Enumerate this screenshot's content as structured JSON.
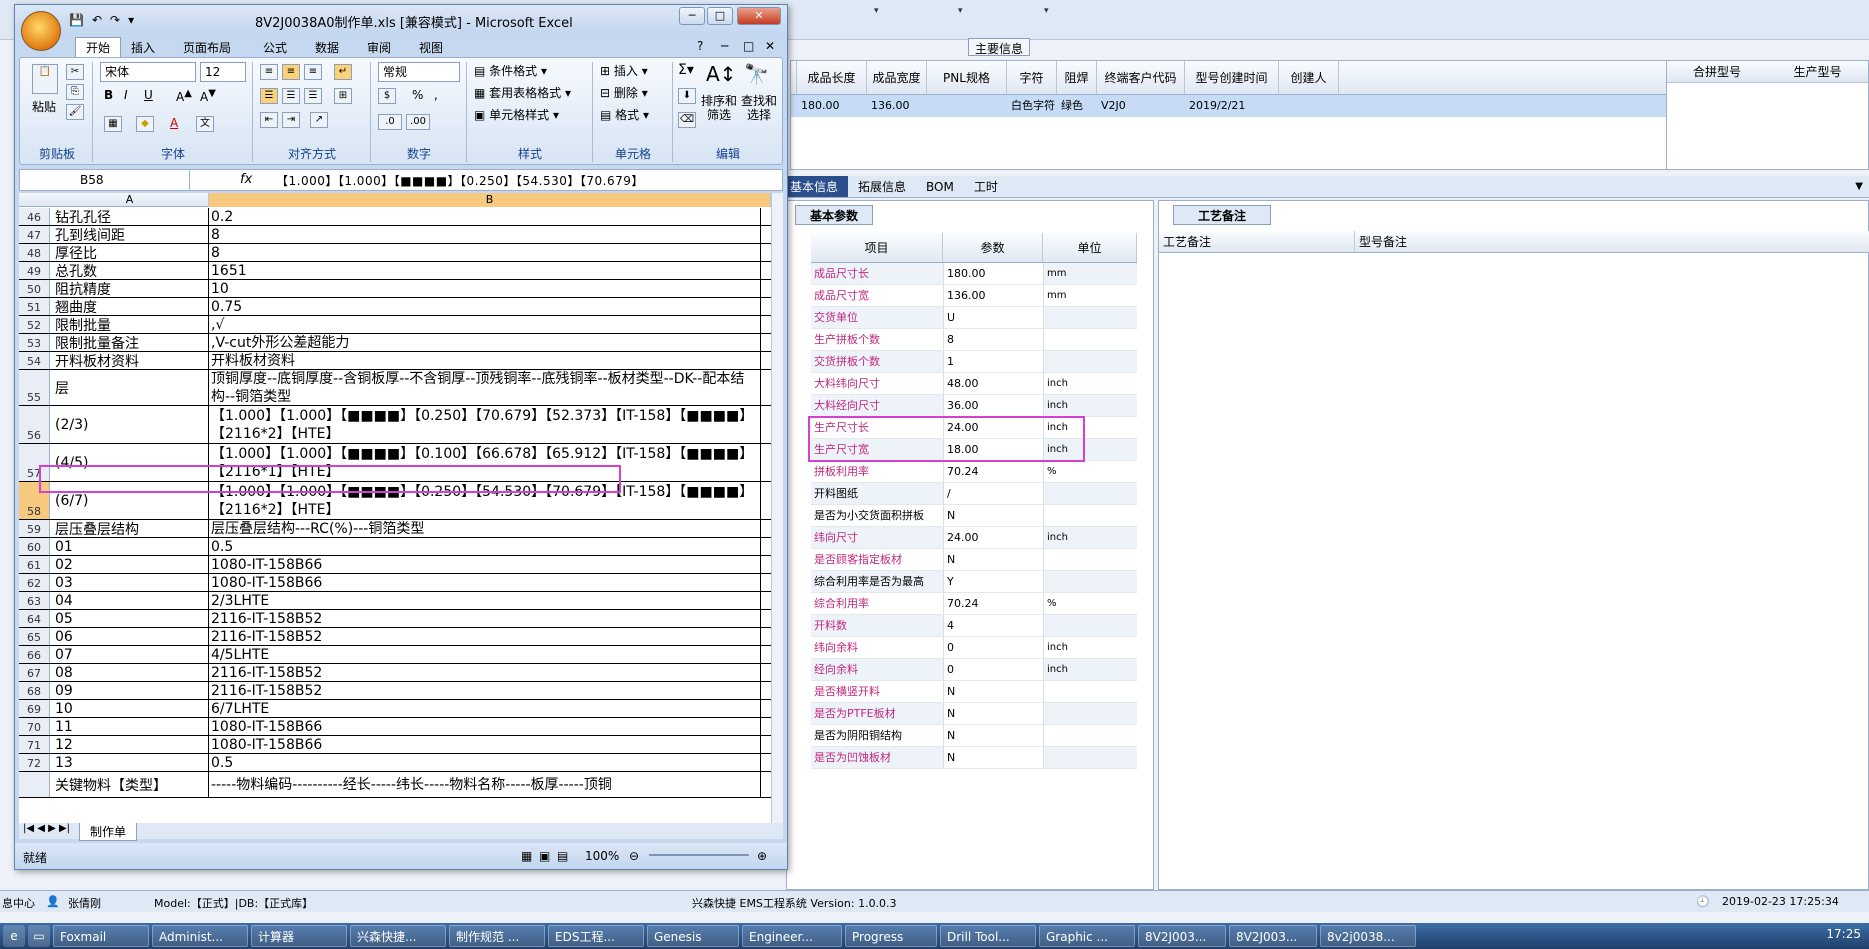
{
  "ems": {
    "main_info_label": "主要信息",
    "grid_headers": [
      "成品长度",
      "成品宽度",
      "PNL规格",
      "字符",
      "阻焊",
      "终端客户代码",
      "型号创建时间",
      "创建人"
    ],
    "grid_row": [
      "180.00",
      "136.00",
      "",
      "白色字符",
      "绿色",
      "V2J0",
      "2019/2/21",
      ""
    ],
    "merge_headers": [
      "合拼型号",
      "生产型号"
    ],
    "tabs": [
      "基本信息",
      "拓展信息",
      "BOM",
      "工时"
    ],
    "base_params_tab": "基本参数",
    "params_headers": [
      "项目",
      "参数",
      "单位"
    ],
    "params": [
      {
        "name": "成品尺寸长",
        "value": "180.00",
        "unit": "mm",
        "pink": true
      },
      {
        "name": "成品尺寸宽",
        "value": "136.00",
        "unit": "mm",
        "pink": true
      },
      {
        "name": "交货单位",
        "value": "U",
        "unit": "",
        "pink": true
      },
      {
        "name": "生产拼板个数",
        "value": "8",
        "unit": "",
        "pink": true
      },
      {
        "name": "交货拼板个数",
        "value": "1",
        "unit": "",
        "pink": true
      },
      {
        "name": "大料纬向尺寸",
        "value": "48.00",
        "unit": "inch",
        "pink": true
      },
      {
        "name": "大料经向尺寸",
        "value": "36.00",
        "unit": "inch",
        "pink": true
      },
      {
        "name": "生产尺寸长",
        "value": "24.00",
        "unit": "inch",
        "pink": true
      },
      {
        "name": "生产尺寸宽",
        "value": "18.00",
        "unit": "inch",
        "pink": true
      },
      {
        "name": "拼板利用率",
        "value": "70.24",
        "unit": "%",
        "pink": true
      },
      {
        "name": "开料图纸",
        "value": "/",
        "unit": "",
        "pink": false
      },
      {
        "name": "是否为小交货面积拼板",
        "value": "N",
        "unit": "",
        "pink": false
      },
      {
        "name": "纬向尺寸",
        "value": "24.00",
        "unit": "inch",
        "pink": true
      },
      {
        "name": "是否顾客指定板材",
        "value": "N",
        "unit": "",
        "pink": true
      },
      {
        "name": "综合利用率是否为最高",
        "value": "Y",
        "unit": "",
        "pink": false
      },
      {
        "name": "综合利用率",
        "value": "70.24",
        "unit": "%",
        "pink": true
      },
      {
        "name": "开料数",
        "value": "4",
        "unit": "",
        "pink": true
      },
      {
        "name": "纬向余料",
        "value": "0",
        "unit": "inch",
        "pink": true
      },
      {
        "name": "经向余料",
        "value": "0",
        "unit": "inch",
        "pink": true
      },
      {
        "name": "是否横竖开料",
        "value": "N",
        "unit": "",
        "pink": true
      },
      {
        "name": "是否为PTFE板材",
        "value": "N",
        "unit": "",
        "pink": true
      },
      {
        "name": "是否为阴阳铜结构",
        "value": "N",
        "unit": "",
        "pink": false
      },
      {
        "name": "是否为凹蚀板材",
        "value": "N",
        "unit": "",
        "pink": true
      }
    ],
    "craft_tab": "工艺备注",
    "craft_headers": [
      "工艺备注",
      "型号备注"
    ],
    "status": {
      "center": "息中心",
      "user": "张倩刚",
      "model": "Model:【正式】|DB:【正式库】",
      "system": "兴森快捷 EMS工程系统 Version: 1.0.0.3",
      "datetime": "2019-02-23 17:25:34"
    }
  },
  "taskbar": {
    "items": [
      "Foxmail",
      "Administ...",
      "计算器",
      "兴森快捷...",
      "制作规范 ...",
      "EDS工程...",
      "Genesis",
      "Engineer...",
      "Progress",
      "Drill Tool...",
      "Graphic ...",
      "8V2J003...",
      "8V2J003...",
      "8v2j0038..."
    ],
    "clock": "17:25"
  },
  "excel": {
    "title": "8V2J0038A0制作单.xls [兼容模式] - Microsoft Excel",
    "ribbon_tabs": [
      "开始",
      "插入",
      "页面布局",
      "公式",
      "数据",
      "审阅",
      "视图"
    ],
    "clipboard_paste": "粘贴",
    "font_name": "宋体",
    "font_size": "12",
    "number_format": "常规",
    "cond_format": "条件格式",
    "table_format": "套用表格格式",
    "cell_style": "单元格样式",
    "insert": "插入",
    "delete": "删除",
    "format": "格式",
    "sort_filter": "排序和筛选",
    "find_select": "查找和选择",
    "groups": [
      "剪贴板",
      "字体",
      "对齐方式",
      "数字",
      "样式",
      "单元格",
      "编辑"
    ],
    "name_box": "B58",
    "formula": "【1.000】【1.000】【■■■■】【0.250】【54.530】【70.679】",
    "col_a": "A",
    "col_b": "B",
    "rows": [
      {
        "n": "46",
        "a": "钻孔孔径",
        "b": "0.2",
        "h": 18
      },
      {
        "n": "47",
        "a": "孔到线间距",
        "b": "8",
        "h": 18
      },
      {
        "n": "48",
        "a": "厚径比",
        "b": "8",
        "h": 18
      },
      {
        "n": "49",
        "a": "总孔数",
        "b": "1651",
        "h": 18
      },
      {
        "n": "50",
        "a": "阻抗精度",
        "b": "10",
        "h": 18
      },
      {
        "n": "51",
        "a": "翘曲度",
        "b": "0.75",
        "h": 18
      },
      {
        "n": "52",
        "a": "限制批量",
        "b": ",√",
        "h": 18
      },
      {
        "n": "53",
        "a": "限制批量备注",
        "b": ",V-cut外形公差超能力",
        "h": 18
      },
      {
        "n": "54",
        "a": "开料板材资料",
        "b": "开料板材资料",
        "h": 18
      },
      {
        "n": "55",
        "a": "层",
        "b": "顶铜厚度--底铜厚度--含铜板厚--不含铜厚--顶残铜率--底残铜率--板材类型--DK--配本结构--铜箔类型",
        "h": 36
      },
      {
        "n": "56",
        "a": "(2/3)",
        "b": "【1.000】【1.000】【■■■■】【0.250】【70.679】【52.373】【IT-158】【■■■■】【2116*2】【HTE】",
        "h": 38
      },
      {
        "n": "57",
        "a": "(4/5)",
        "b": "【1.000】【1.000】【■■■■】【0.100】【66.678】【65.912】【IT-158】【■■■■】【2116*1】【HTE】",
        "h": 38
      },
      {
        "n": "58",
        "a": "(6/7)",
        "b": "【1.000】【1.000】【■■■■】【0.250】【54.530】【70.679】【IT-158】【■■■■】【2116*2】【HTE】",
        "h": 38,
        "sel": true
      },
      {
        "n": "59",
        "a": "层压叠层结构",
        "b": "层压叠层结构---RC(%)---铜箔类型",
        "h": 18
      },
      {
        "n": "60",
        "a": "01",
        "b": "0.5",
        "h": 18
      },
      {
        "n": "61",
        "a": "02",
        "b": "1080-IT-158B66",
        "h": 18
      },
      {
        "n": "62",
        "a": "03",
        "b": "1080-IT-158B66",
        "h": 18
      },
      {
        "n": "63",
        "a": "04",
        "b": "2/3LHTE",
        "h": 18
      },
      {
        "n": "64",
        "a": "05",
        "b": "2116-IT-158B52",
        "h": 18
      },
      {
        "n": "65",
        "a": "06",
        "b": "2116-IT-158B52",
        "h": 18
      },
      {
        "n": "66",
        "a": "07",
        "b": "4/5LHTE",
        "h": 18
      },
      {
        "n": "67",
        "a": "08",
        "b": "2116-IT-158B52",
        "h": 18
      },
      {
        "n": "68",
        "a": "09",
        "b": "2116-IT-158B52",
        "h": 18
      },
      {
        "n": "69",
        "a": "10",
        "b": "6/7LHTE",
        "h": 18
      },
      {
        "n": "70",
        "a": "11",
        "b": "1080-IT-158B66",
        "h": 18
      },
      {
        "n": "71",
        "a": "12",
        "b": "1080-IT-158B66",
        "h": 18
      },
      {
        "n": "72",
        "a": "13",
        "b": "0.5",
        "h": 18
      },
      {
        "n": "",
        "a": "关键物料【类型】",
        "b": "-----物料编码----------经长-----纬长-----物料名称-----板厚-----顶铜",
        "h": 26
      }
    ],
    "sheet_tab": "制作单",
    "status_ready": "就绪",
    "zoom": "100%"
  }
}
